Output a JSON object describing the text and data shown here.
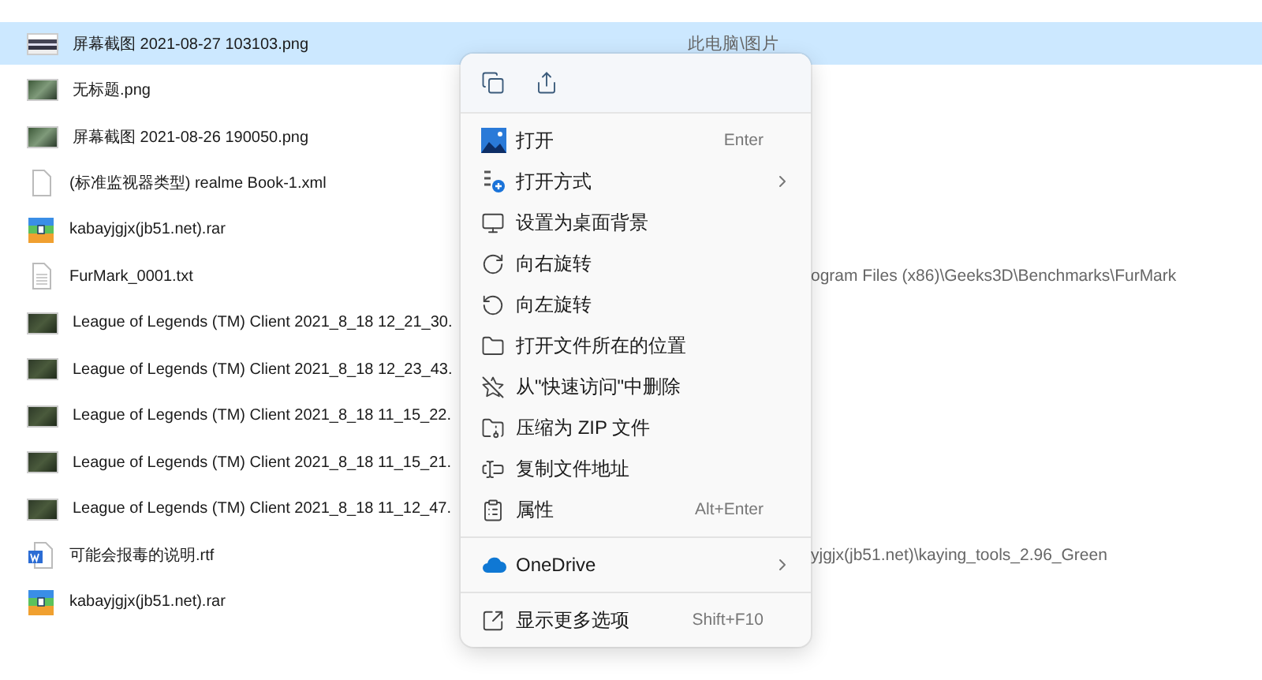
{
  "files": [
    {
      "name": "屏幕截图 2021-08-27 103103.png",
      "kind": "screenshot",
      "selected": true,
      "location": "此电脑\\图片",
      "location_clipped": false
    },
    {
      "name": "无标题.png",
      "kind": "photo",
      "selected": false
    },
    {
      "name": "屏幕截图 2021-08-26 190050.png",
      "kind": "photo",
      "selected": false
    },
    {
      "name": "(标准监视器类型) realme Book-1.xml",
      "kind": "document",
      "selected": false
    },
    {
      "name": "kabayjgjx(jb51.net).rar",
      "kind": "archive",
      "selected": false
    },
    {
      "name": "FurMark_0001.txt",
      "kind": "text",
      "selected": false,
      "location": "ogram Files (x86)\\Geeks3D\\Benchmarks\\FurMark",
      "location_clipped": true
    },
    {
      "name": "League of Legends (TM) Client 2021_8_18 12_21_30.",
      "kind": "game",
      "selected": false
    },
    {
      "name": "League of Legends (TM) Client 2021_8_18 12_23_43.",
      "kind": "game",
      "selected": false
    },
    {
      "name": "League of Legends (TM) Client 2021_8_18 11_15_22.",
      "kind": "game",
      "selected": false
    },
    {
      "name": "League of Legends (TM) Client 2021_8_18 11_15_21.",
      "kind": "game",
      "selected": false
    },
    {
      "name": "League of Legends (TM) Client 2021_8_18 11_12_47.",
      "kind": "game",
      "selected": false
    },
    {
      "name": "可能会报毒的说明.rtf",
      "kind": "word",
      "selected": false,
      "location": "yjgjx(jb51.net)\\kaying_tools_2.96_Green",
      "location_clipped": true
    },
    {
      "name": "kabayjgjx(jb51.net).rar",
      "kind": "archive",
      "selected": false
    }
  ],
  "context_menu": {
    "quick_actions": [
      {
        "kind": "copy"
      },
      {
        "kind": "share"
      }
    ],
    "groups": [
      [
        {
          "label": "打开",
          "kind": "open",
          "shortcut": "Enter",
          "submenu": false
        },
        {
          "label": "打开方式",
          "kind": "open-with",
          "submenu": true
        },
        {
          "label": "设置为桌面背景",
          "kind": "wallpaper",
          "submenu": false
        },
        {
          "label": "向右旋转",
          "kind": "rotate-right",
          "submenu": false
        },
        {
          "label": "向左旋转",
          "kind": "rotate-left",
          "submenu": false
        },
        {
          "label": "打开文件所在的位置",
          "kind": "folder",
          "submenu": false
        },
        {
          "label": "从\"快速访问\"中删除",
          "kind": "unpin",
          "submenu": false
        },
        {
          "label": "压缩为 ZIP 文件",
          "kind": "zip",
          "submenu": false
        },
        {
          "label": "复制文件地址",
          "kind": "path",
          "submenu": false
        },
        {
          "label": "属性",
          "kind": "properties",
          "shortcut": "Alt+Enter",
          "submenu": false
        }
      ],
      [
        {
          "label": "OneDrive",
          "kind": "cloud",
          "submenu": true
        }
      ],
      [
        {
          "label": "显示更多选项",
          "kind": "more",
          "shortcut": "Shift+F10",
          "submenu": false
        }
      ]
    ]
  }
}
